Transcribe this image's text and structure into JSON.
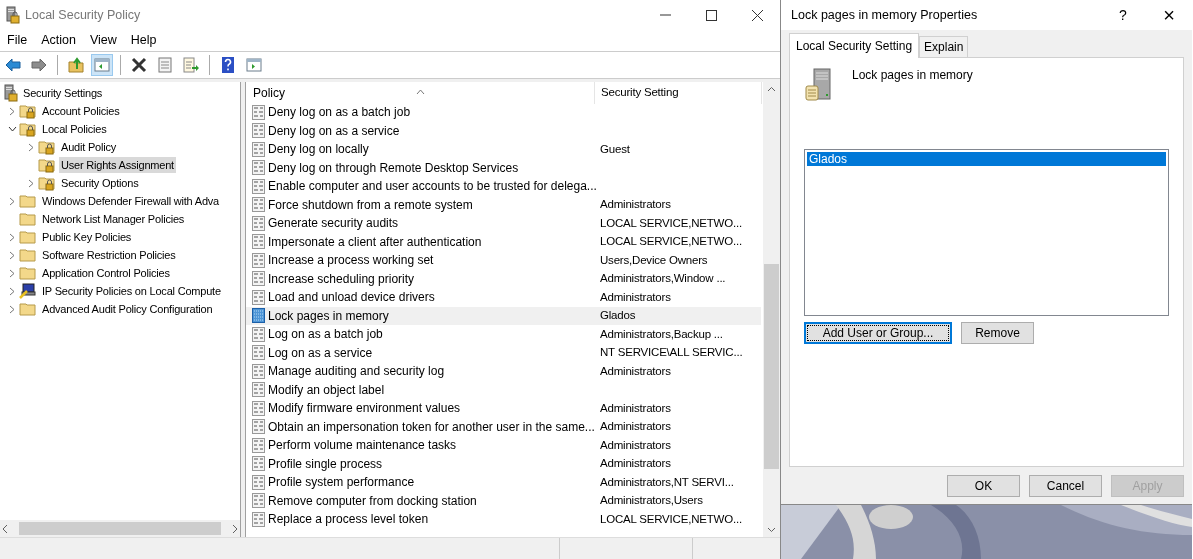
{
  "main_window": {
    "title": "Local Security Policy",
    "menu": [
      "File",
      "Action",
      "View",
      "Help"
    ],
    "toolbar_groups": [
      [
        {
          "kind": "back",
          "pressed": false
        },
        {
          "kind": "forward",
          "pressed": false
        }
      ],
      [
        {
          "kind": "up",
          "pressed": false
        },
        {
          "kind": "console-tree",
          "pressed": true
        }
      ],
      [
        {
          "kind": "delete",
          "pressed": false
        },
        {
          "kind": "properties",
          "pressed": false
        },
        {
          "kind": "export",
          "pressed": false
        }
      ],
      [
        {
          "kind": "help",
          "pressed": false
        },
        {
          "kind": "view",
          "pressed": false
        }
      ]
    ],
    "tree": {
      "label": "Security Settings",
      "kind": "root",
      "selected": false,
      "children": [
        {
          "label": "Account Policies",
          "kind": "locked-folder",
          "expandable": true,
          "expanded": false,
          "selected": false
        },
        {
          "label": "Local Policies",
          "kind": "locked-folder",
          "expandable": true,
          "expanded": true,
          "selected": false,
          "children": [
            {
              "label": "Audit Policy",
              "kind": "locked-folder",
              "expandable": true,
              "expanded": false,
              "selected": false
            },
            {
              "label": "User Rights Assignment",
              "kind": "locked-folder",
              "expandable": false,
              "selected": true
            },
            {
              "label": "Security Options",
              "kind": "locked-folder",
              "expandable": true,
              "expanded": false,
              "selected": false
            }
          ]
        },
        {
          "label": "Windows Defender Firewall with Adva",
          "kind": "folder",
          "expandable": true,
          "expanded": false,
          "selected": false
        },
        {
          "label": "Network List Manager Policies",
          "kind": "folder",
          "expandable": false,
          "selected": false
        },
        {
          "label": "Public Key Policies",
          "kind": "folder",
          "expandable": true,
          "expanded": false,
          "selected": false
        },
        {
          "label": "Software Restriction Policies",
          "kind": "folder",
          "expandable": true,
          "expanded": false,
          "selected": false
        },
        {
          "label": "Application Control Policies",
          "kind": "folder",
          "expandable": true,
          "expanded": false,
          "selected": false
        },
        {
          "label": "IP Security Policies on Local Compute",
          "kind": "ip-security",
          "expandable": true,
          "expanded": false,
          "selected": false
        },
        {
          "label": "Advanced Audit Policy Configuration",
          "kind": "folder",
          "expandable": true,
          "expanded": false,
          "selected": false
        }
      ]
    },
    "list": {
      "columns": [
        {
          "label": "Policy",
          "sorted": true
        },
        {
          "label": "Security Setting",
          "sorted": false
        }
      ],
      "rows": [
        {
          "policy": "Deny log on as a batch job",
          "setting": "",
          "selected": false
        },
        {
          "policy": "Deny log on as a service",
          "setting": "",
          "selected": false
        },
        {
          "policy": "Deny log on locally",
          "setting": "Guest",
          "selected": false
        },
        {
          "policy": "Deny log on through Remote Desktop Services",
          "setting": "",
          "selected": false
        },
        {
          "policy": "Enable computer and user accounts to be trusted for delega...",
          "setting": "",
          "selected": false
        },
        {
          "policy": "Force shutdown from a remote system",
          "setting": "Administrators",
          "selected": false
        },
        {
          "policy": "Generate security audits",
          "setting": "LOCAL SERVICE,NETWO...",
          "selected": false
        },
        {
          "policy": "Impersonate a client after authentication",
          "setting": "LOCAL SERVICE,NETWO...",
          "selected": false
        },
        {
          "policy": "Increase a process working set",
          "setting": "Users,Device Owners",
          "selected": false
        },
        {
          "policy": "Increase scheduling priority",
          "setting": "Administrators,Window ...",
          "selected": false
        },
        {
          "policy": "Load and unload device drivers",
          "setting": "Administrators",
          "selected": false
        },
        {
          "policy": "Lock pages in memory",
          "setting": "Glados",
          "selected": true
        },
        {
          "policy": "Log on as a batch job",
          "setting": "Administrators,Backup ...",
          "selected": false
        },
        {
          "policy": "Log on as a service",
          "setting": "NT SERVICE\\ALL SERVIC...",
          "selected": false
        },
        {
          "policy": "Manage auditing and security log",
          "setting": "Administrators",
          "selected": false
        },
        {
          "policy": "Modify an object label",
          "setting": "",
          "selected": false
        },
        {
          "policy": "Modify firmware environment values",
          "setting": "Administrators",
          "selected": false
        },
        {
          "policy": "Obtain an impersonation token for another user in the same...",
          "setting": "Administrators",
          "selected": false
        },
        {
          "policy": "Perform volume maintenance tasks",
          "setting": "Administrators",
          "selected": false
        },
        {
          "policy": "Profile single process",
          "setting": "Administrators",
          "selected": false
        },
        {
          "policy": "Profile system performance",
          "setting": "Administrators,NT SERVI...",
          "selected": false
        },
        {
          "policy": "Remove computer from docking station",
          "setting": "Administrators,Users",
          "selected": false
        },
        {
          "policy": "Replace a process level token",
          "setting": "LOCAL SERVICE,NETWO...",
          "selected": false
        }
      ]
    }
  },
  "dialog": {
    "title": "Lock pages in memory Properties",
    "help_glyph": "?",
    "close_glyph": "×",
    "tabs": [
      {
        "label": "Local Security Setting",
        "selected": true
      },
      {
        "label": "Explain",
        "selected": false
      }
    ],
    "policy_name": "Lock pages in memory",
    "principals": [
      {
        "name": "Glados",
        "selected": true
      }
    ],
    "list_buttons": [
      {
        "label": "Add User or Group...",
        "focused": true,
        "disabled": false
      },
      {
        "label": "Remove",
        "focused": false,
        "disabled": false
      }
    ],
    "footer_buttons": [
      {
        "label": "OK",
        "focused": false,
        "disabled": false
      },
      {
        "label": "Cancel",
        "focused": false,
        "disabled": false
      },
      {
        "label": "Apply",
        "focused": false,
        "disabled": true
      }
    ]
  }
}
